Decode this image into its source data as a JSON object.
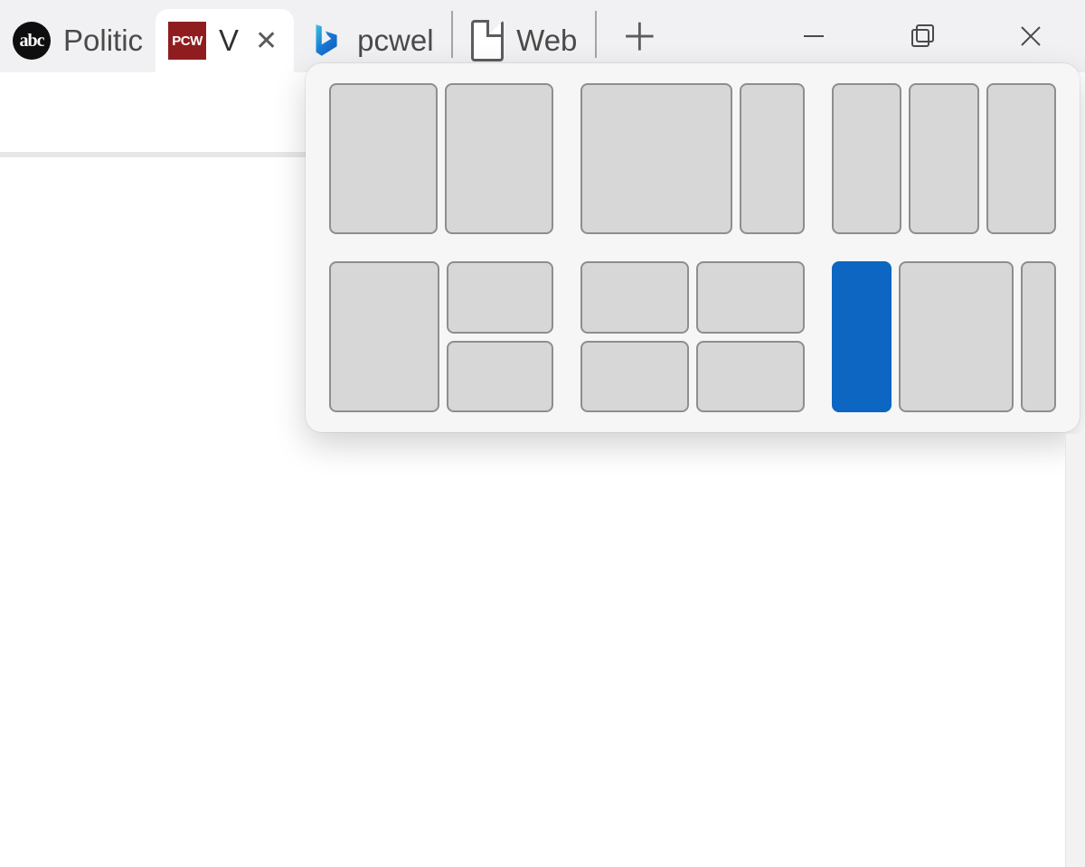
{
  "tabs": [
    {
      "favicon": "abc",
      "title": "Politic",
      "active": false
    },
    {
      "favicon": "pcw",
      "title": "V",
      "active": true
    },
    {
      "favicon": "bing",
      "title": "pcwel",
      "active": false
    },
    {
      "favicon": "page",
      "title": "Web",
      "active": false
    }
  ],
  "favicon_text": {
    "abc": "abc",
    "pcw": "PCW"
  },
  "window_controls": {
    "minimize": "Minimize",
    "maximize": "Maximize",
    "close": "Close"
  },
  "new_tab_tooltip": "New tab",
  "snap_layouts": {
    "selected": {
      "layout": 6,
      "zone": 1
    },
    "options": [
      {
        "id": 1,
        "zones": 2,
        "pattern": "two-column-even"
      },
      {
        "id": 2,
        "zones": 2,
        "pattern": "wide-narrow"
      },
      {
        "id": 3,
        "zones": 3,
        "pattern": "three-column"
      },
      {
        "id": 4,
        "zones": 3,
        "pattern": "left-plus-stacked-right"
      },
      {
        "id": 5,
        "zones": 4,
        "pattern": "two-by-two"
      },
      {
        "id": 6,
        "zones": 3,
        "pattern": "narrow-wide-narrow"
      }
    ]
  }
}
